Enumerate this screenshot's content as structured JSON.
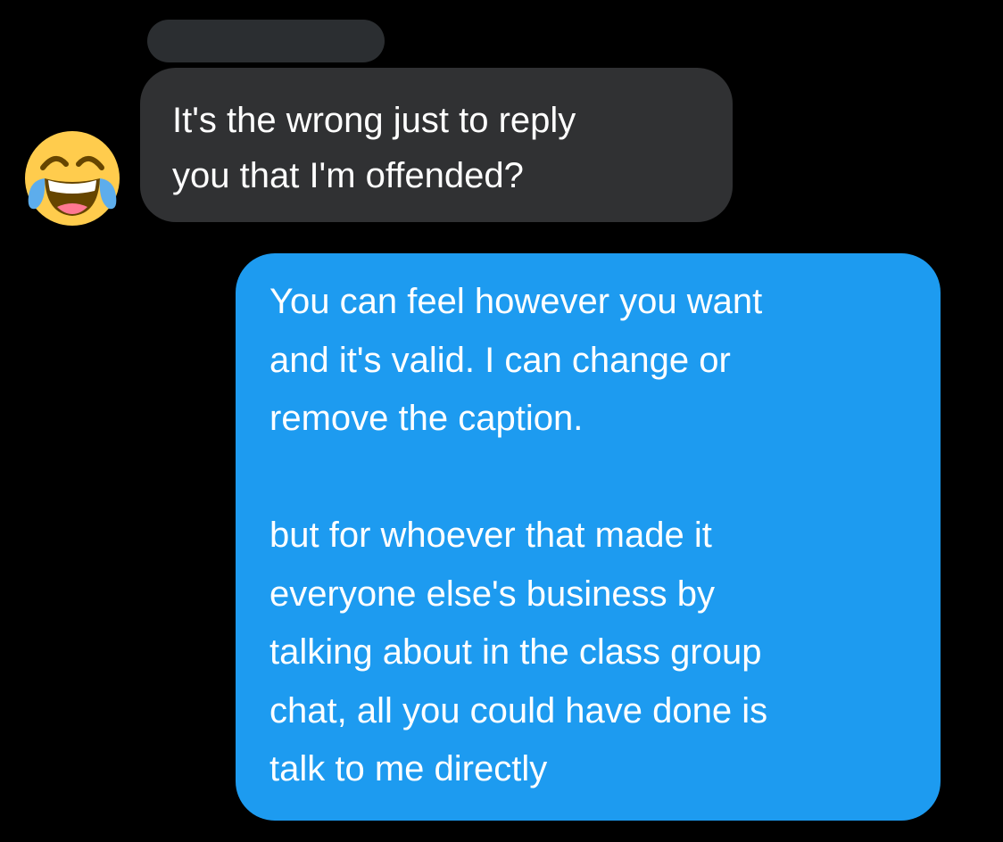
{
  "conversation": {
    "received": {
      "avatar_icon": "face-with-tears-of-joy-emoji-icon",
      "message": "It's the wrong just to reply\nyou that I'm offended?"
    },
    "sent": {
      "message": "You can feel however you want\nand it's valid. I can change or\nremove the caption.\n\nbut for whoever that made it\neveryone else's business by\ntalking about in the class group\nchat, all you could have done is\ntalk to me directly"
    }
  },
  "colors": {
    "background": "#000000",
    "incoming_bubble": "#303133",
    "outgoing_bubble": "#1d9bf0",
    "redaction": "#2b2e31",
    "text": "#ffffff"
  }
}
